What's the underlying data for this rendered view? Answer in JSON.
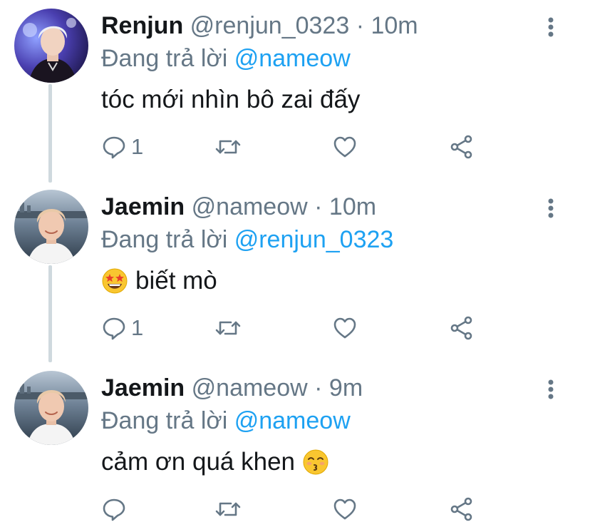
{
  "thread": {
    "tweets": [
      {
        "display_name": "Renjun",
        "handle": "@renjun_0323",
        "separator": "·",
        "time": "10m",
        "reply_prefix": "Đang trả lời",
        "reply_to": "@nameow",
        "text": "tóc mới nhìn bô zai đấy",
        "emoji_before": "",
        "emoji_after": "",
        "reply_count": "1",
        "avatar_icon": "user-avatar-renjun"
      },
      {
        "display_name": "Jaemin",
        "handle": "@nameow",
        "separator": "·",
        "time": "10m",
        "reply_prefix": "Đang trả lời",
        "reply_to": "@renjun_0323",
        "text": "biết mò",
        "emoji_before": "star-struck-emoji",
        "emoji_after": "",
        "reply_count": "1",
        "avatar_icon": "user-avatar-jaemin"
      },
      {
        "display_name": "Jaemin",
        "handle": "@nameow",
        "separator": "·",
        "time": "9m",
        "reply_prefix": "Đang trả lời",
        "reply_to": "@nameow",
        "text": "cảm ơn quá khen",
        "emoji_before": "",
        "emoji_after": "kissing-emoji",
        "reply_count": "",
        "avatar_icon": "user-avatar-jaemin"
      }
    ]
  },
  "colors": {
    "handle_gray": "#657786",
    "mention_blue": "#1da1f2",
    "text_black": "#14171a",
    "thread_line": "#cfd9de"
  },
  "icons": {
    "reply": "reply-icon",
    "retweet": "retweet-icon",
    "like": "heart-icon",
    "share": "share-icon",
    "more": "more-vertical-icon"
  }
}
